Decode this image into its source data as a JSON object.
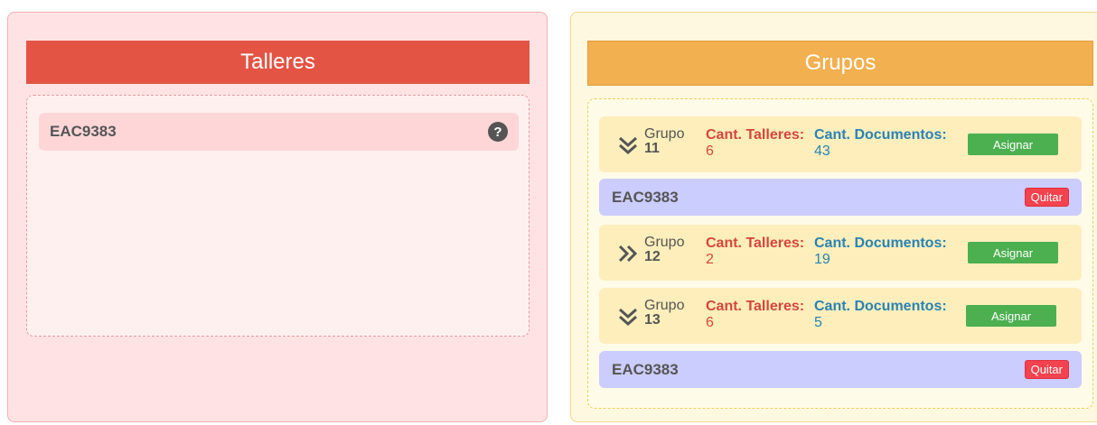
{
  "talleres": {
    "title": "Talleres",
    "items": [
      {
        "code": "EAC9383",
        "icon": "question-circle-icon"
      }
    ]
  },
  "grupos": {
    "title": "Grupos",
    "groups": [
      {
        "label": "Grupo",
        "number": "11",
        "expanded": true,
        "talleres_label": "Cant. Talleres:",
        "talleres_count": "6",
        "documentos_label": "Cant. Documentos:",
        "documentos_count": "43",
        "assign_label": "Asignar",
        "assigned": [
          {
            "code": "EAC9383",
            "remove_label": "Quitar"
          }
        ]
      },
      {
        "label": "Grupo",
        "number": "12",
        "expanded": false,
        "talleres_label": "Cant. Talleres:",
        "talleres_count": "2",
        "documentos_label": "Cant. Documentos:",
        "documentos_count": "19",
        "assign_label": "Asignar",
        "assigned": []
      },
      {
        "label": "Grupo",
        "number": "13",
        "expanded": true,
        "talleres_label": "Cant. Talleres:",
        "talleres_count": "6",
        "documentos_label": "Cant. Documentos:",
        "documentos_count": "5",
        "assign_label": "Asignar",
        "assigned": [
          {
            "code": "EAC9383",
            "remove_label": "Quitar"
          }
        ]
      }
    ]
  },
  "colors": {
    "talleres_header": "#e35444",
    "grupos_header": "#f2b050",
    "assign_button": "#4caf50",
    "remove_button": "#f2434f",
    "assigned_item_bg": "#cbccff"
  }
}
